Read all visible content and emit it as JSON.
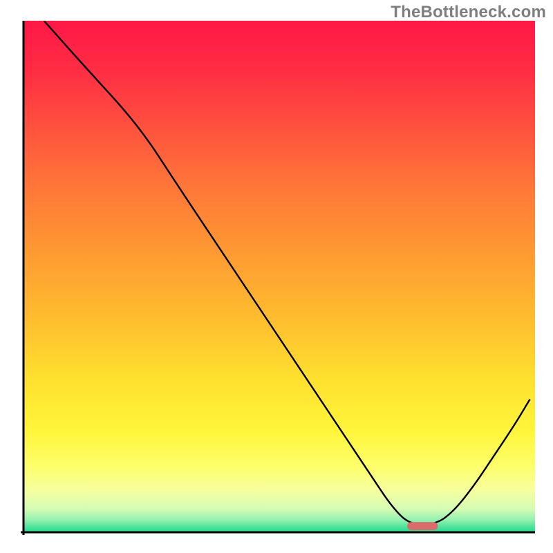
{
  "watermark": "TheBottleneck.com",
  "chart_data": {
    "type": "line",
    "title": "",
    "xlabel": "",
    "ylabel": "",
    "xlim": [
      0,
      100
    ],
    "ylim": [
      0,
      100
    ],
    "gradient_stops": [
      {
        "offset": 0.0,
        "color": "#ff1846"
      },
      {
        "offset": 0.09,
        "color": "#ff2b44"
      },
      {
        "offset": 0.2,
        "color": "#ff4f3f"
      },
      {
        "offset": 0.32,
        "color": "#ff7539"
      },
      {
        "offset": 0.45,
        "color": "#ff9933"
      },
      {
        "offset": 0.58,
        "color": "#ffbc2f"
      },
      {
        "offset": 0.7,
        "color": "#ffe02f"
      },
      {
        "offset": 0.8,
        "color": "#fff53a"
      },
      {
        "offset": 0.87,
        "color": "#feff69"
      },
      {
        "offset": 0.92,
        "color": "#f5ffa0"
      },
      {
        "offset": 0.955,
        "color": "#d4fcb4"
      },
      {
        "offset": 0.975,
        "color": "#97f2b0"
      },
      {
        "offset": 0.99,
        "color": "#4be39b"
      },
      {
        "offset": 1.0,
        "color": "#1fdc8f"
      }
    ],
    "series": [
      {
        "name": "bottleneck-curve",
        "x": [
          4.0,
          12.0,
          22.5,
          30.0,
          40.0,
          50.0,
          60.0,
          68.0,
          72.0,
          75.5,
          80.5,
          84.0,
          88.0,
          92.0,
          96.0,
          99.0
        ],
        "y": [
          100.0,
          91.0,
          79.5,
          68.0,
          53.0,
          38.0,
          23.0,
          11.0,
          5.0,
          1.5,
          1.5,
          4.0,
          9.0,
          15.0,
          21.0,
          26.0
        ]
      }
    ],
    "marker": {
      "name": "optimal-region",
      "x_center": 78.0,
      "y_center": 1.2,
      "width": 6.0,
      "height": 1.6,
      "color": "#d86b6b"
    },
    "axes_color": "#000000",
    "curve_color": "#000000",
    "curve_width": 2.4
  }
}
